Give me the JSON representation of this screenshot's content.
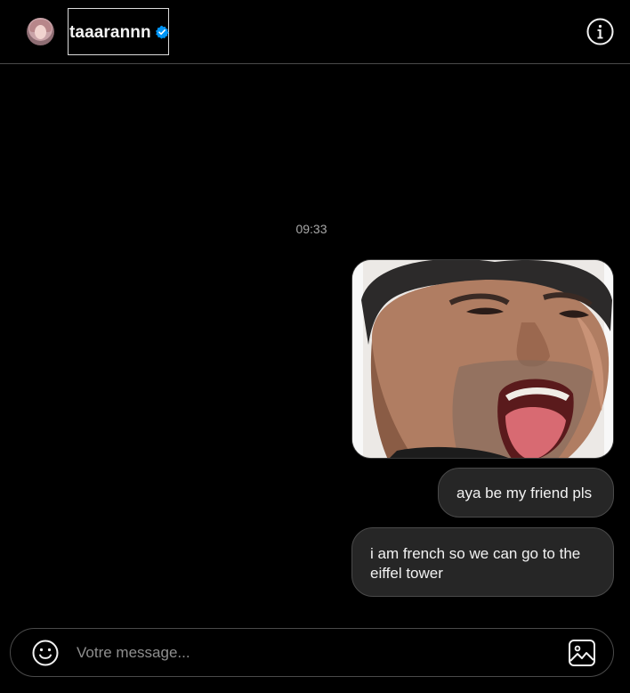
{
  "header": {
    "username": "taaarannn",
    "verified_icon": "verified-badge-icon",
    "info_icon": "info-icon"
  },
  "chat": {
    "timestamp": "09:33",
    "messages": [
      {
        "type": "image",
        "description_icon": "photo-message"
      },
      {
        "type": "text",
        "text": "aya be my friend pls"
      },
      {
        "type": "text",
        "text": "i am french so we can go to the eiffel tower"
      }
    ]
  },
  "composer": {
    "placeholder": "Votre message...",
    "emoji_icon": "emoji-icon",
    "image_icon": "image-icon"
  },
  "colors": {
    "background": "#000000",
    "bubble": "#262626",
    "border": "#4a4a4a",
    "verified": "#0095f6",
    "muted_text": "#a8a8a8"
  }
}
